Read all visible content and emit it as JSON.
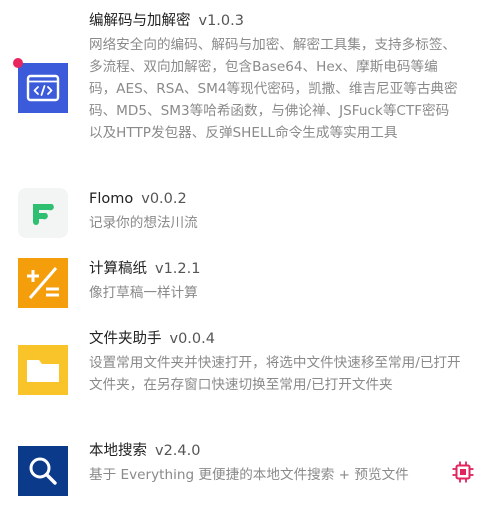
{
  "colors": {
    "update_dot": "#e8265e",
    "codec_icon_bg": "#3b5bdb",
    "flomo_icon_bg": "#f3f5f4",
    "flomo_icon_fg": "#2fbf71",
    "calc_icon_bg": "#f59e0b",
    "folder_icon_bg": "#f8c42a",
    "search_icon_bg": "#0b3a8a",
    "chip_icon": "#e0245e"
  },
  "plugins": [
    {
      "name": "编解码与加解密",
      "version": "v1.0.3",
      "description": "网络安全向的编码、解码与加密、解密工具集，支持多标签、多流程、双向加解密，包含Base64、Hex、摩斯电码等编码，AES、RSA、SM4等现代密码，凯撒、维吉尼亚等古典密码、MD5、SM3等哈希函数，与佛论禅、JSFuck等CTF密码以及HTTP发包器、反弹SHELL命令生成等实用工具",
      "icon": "code-window-icon",
      "has_update": true
    },
    {
      "name": "Flomo",
      "version": "v0.0.2",
      "description": "记录你的想法川流",
      "icon": "flomo-logo-icon",
      "has_update": false
    },
    {
      "name": "计算稿纸",
      "version": "v1.2.1",
      "description": "像打草稿一样计算",
      "icon": "calculator-icon",
      "has_update": false
    },
    {
      "name": "文件夹助手",
      "version": "v0.0.4",
      "description": "设置常用文件夹并快速打开，将选中文件快速移至常用/已打开文件夹，在另存窗口快速切换至常用/已打开文件夹",
      "icon": "folder-icon",
      "has_update": false
    },
    {
      "name": "本地搜索",
      "version": "v2.4.0",
      "description": "基于 Everything 更便捷的本地文件搜索 + 预览文件",
      "icon": "magnifier-icon",
      "has_update": false,
      "action_icon": "chip-icon"
    }
  ]
}
